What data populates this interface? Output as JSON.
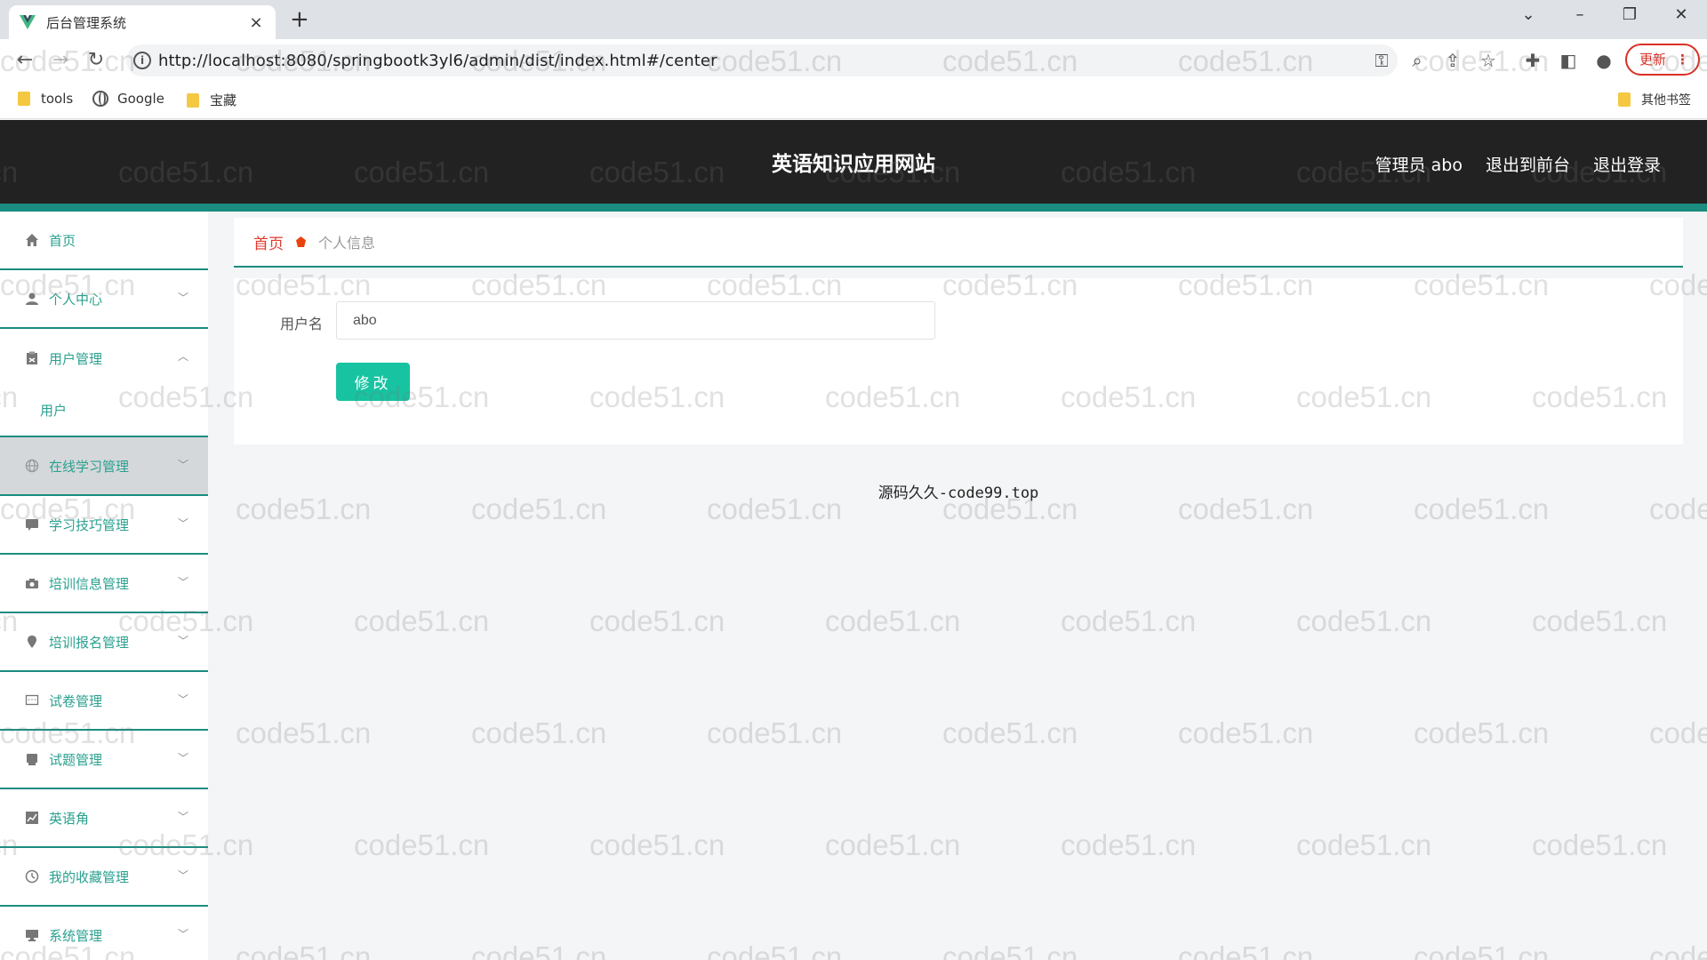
{
  "browser": {
    "tab_title": "后台管理系统",
    "tab_close": "×",
    "new_tab": "+",
    "url": "http://localhost:8080/springbootk3yl6/admin/dist/index.html#/center",
    "update_label": "更新",
    "bookmarks": [
      {
        "label": "tools",
        "icon": "folder-icon"
      },
      {
        "label": "Google",
        "icon": "globe-icon"
      },
      {
        "label": "宝藏",
        "icon": "folder-icon"
      }
    ],
    "other_bookmarks": "其他书签"
  },
  "header": {
    "title": "英语知识应用网站",
    "admin_label": "管理员 abo",
    "to_frontend": "退出到前台",
    "logout": "退出登录"
  },
  "sidebar": {
    "items": [
      {
        "label": "首页",
        "icon": "home-icon",
        "has_arrow": false
      },
      {
        "label": "个人中心",
        "icon": "user-icon",
        "has_arrow": true
      },
      {
        "label": "用户管理",
        "icon": "clipboard-icon",
        "has_arrow": true,
        "expanded": true
      },
      {
        "label": "在线学习管理",
        "icon": "globe-icon",
        "has_arrow": true,
        "active": true
      },
      {
        "label": "学习技巧管理",
        "icon": "chat-icon",
        "has_arrow": true
      },
      {
        "label": "培训信息管理",
        "icon": "camera-icon",
        "has_arrow": true
      },
      {
        "label": "培训报名管理",
        "icon": "pin-icon",
        "has_arrow": true
      },
      {
        "label": "试卷管理",
        "icon": "message-icon",
        "has_arrow": true
      },
      {
        "label": "试题管理",
        "icon": "printer-icon",
        "has_arrow": true
      },
      {
        "label": "英语角",
        "icon": "chart-icon",
        "has_arrow": true
      },
      {
        "label": "我的收藏管理",
        "icon": "compass-icon",
        "has_arrow": true
      },
      {
        "label": "系统管理",
        "icon": "monitor-icon",
        "has_arrow": true
      }
    ],
    "submenu": {
      "label": "用户"
    }
  },
  "breadcrumb": {
    "home": "首页",
    "current": "个人信息"
  },
  "form": {
    "username_label": "用户名",
    "username_value": "abo",
    "submit_label": "修改"
  },
  "footer": {
    "text": "源码久久-code99.top"
  },
  "watermark": "code51.cn",
  "colors": {
    "accent": "#1a8d80",
    "button": "#17c3a0",
    "menu_text": "#2aa08f",
    "header_bg": "#222222",
    "breadcrumb_home": "#e03b2f"
  }
}
